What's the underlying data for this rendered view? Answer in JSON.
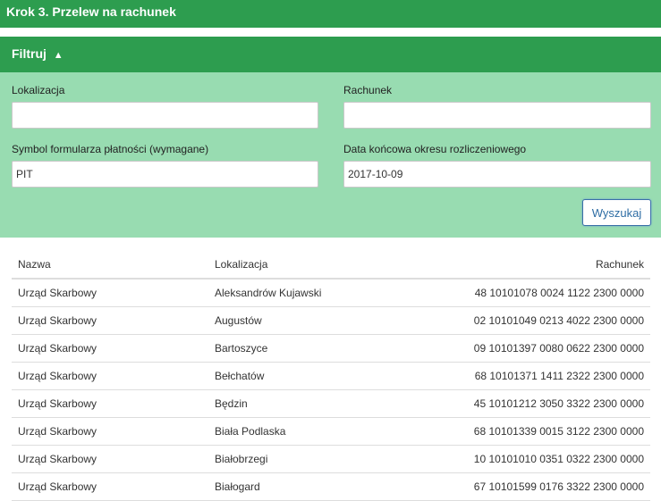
{
  "step": {
    "title": "Krok 3. Przelew na rachunek"
  },
  "filter": {
    "toggle_label": "Filtruj",
    "toggle_icon": "triangle-up-icon",
    "toggle_glyph": "▲",
    "fields": {
      "location": {
        "label": "Lokalizacja",
        "value": ""
      },
      "account": {
        "label": "Rachunek",
        "value": ""
      },
      "form_symbol": {
        "label": "Symbol formularza płatności (wymagane)",
        "value": "PIT"
      },
      "end_date": {
        "label": "Data końcowa okresu rozliczeniowego",
        "value": "2017-10-09"
      }
    },
    "search_label": "Wyszukaj"
  },
  "table": {
    "headers": {
      "name": "Nazwa",
      "location": "Lokalizacja",
      "account": "Rachunek"
    },
    "rows": [
      {
        "name": "Urząd Skarbowy",
        "location": "Aleksandrów Kujawski",
        "account": "48 10101078 0024 1122 2300 0000"
      },
      {
        "name": "Urząd Skarbowy",
        "location": "Augustów",
        "account": "02 10101049 0213 4022 2300 0000"
      },
      {
        "name": "Urząd Skarbowy",
        "location": "Bartoszyce",
        "account": "09 10101397 0080 0622 2300 0000"
      },
      {
        "name": "Urząd Skarbowy",
        "location": "Bełchatów",
        "account": "68 10101371 1411 2322 2300 0000"
      },
      {
        "name": "Urząd Skarbowy",
        "location": "Będzin",
        "account": "45 10101212 3050 3322 2300 0000"
      },
      {
        "name": "Urząd Skarbowy",
        "location": "Biała Podlaska",
        "account": "68 10101339 0015 3122 2300 0000"
      },
      {
        "name": "Urząd Skarbowy",
        "location": "Białobrzegi",
        "account": "10 10101010 0351 0322 2300 0000"
      },
      {
        "name": "Urząd Skarbowy",
        "location": "Białogard",
        "account": "67 10101599 0176 3322 2300 0000"
      }
    ]
  },
  "colors": {
    "header_green": "#2d9d4f",
    "panel_green": "#98dcb1",
    "button_blue": "#2e6da4"
  }
}
